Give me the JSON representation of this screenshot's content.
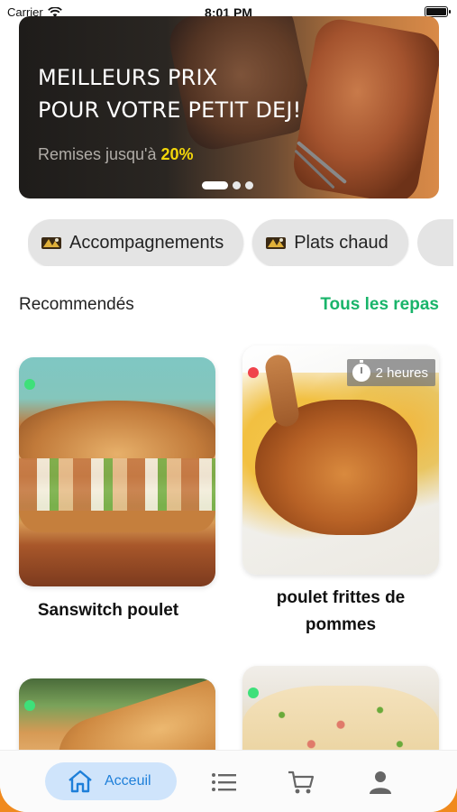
{
  "status_bar": {
    "carrier": "Carrier",
    "time": "8:01 PM"
  },
  "banner": {
    "title_line1": "MEILLEURS PRIX",
    "title_line2": "POUR VOTRE PETIT DEJ!",
    "promo_text": "Remises jusqu'à",
    "promo_highlight": "20%",
    "slides": 3,
    "active_slide": 1
  },
  "categories": [
    {
      "label": "Accompagnements",
      "icon": "food-category-icon"
    },
    {
      "label": "Plats chaud",
      "icon": "food-category-icon"
    }
  ],
  "section": {
    "title": "Recommendés",
    "see_all": "Tous les repas"
  },
  "meals": [
    {
      "name": "Sanswitch poulet",
      "status_color": "#3ee07a"
    },
    {
      "name": "poulet frittes de pommes",
      "status_color": "#f0434b",
      "prep_time": "2 heures"
    },
    {
      "name": "",
      "status_color": "#3ee07a"
    },
    {
      "name": "",
      "status_color": "#3ee07a"
    }
  ],
  "nav": {
    "home_label": "Acceuil",
    "items": [
      "home-icon",
      "list-icon",
      "cart-icon",
      "profile-icon"
    ]
  },
  "colors": {
    "accent_green": "#19b46a",
    "nav_active_bg": "#cfe4fb",
    "nav_active_fg": "#1e7fd9",
    "promo_yellow": "#f2d60a"
  }
}
